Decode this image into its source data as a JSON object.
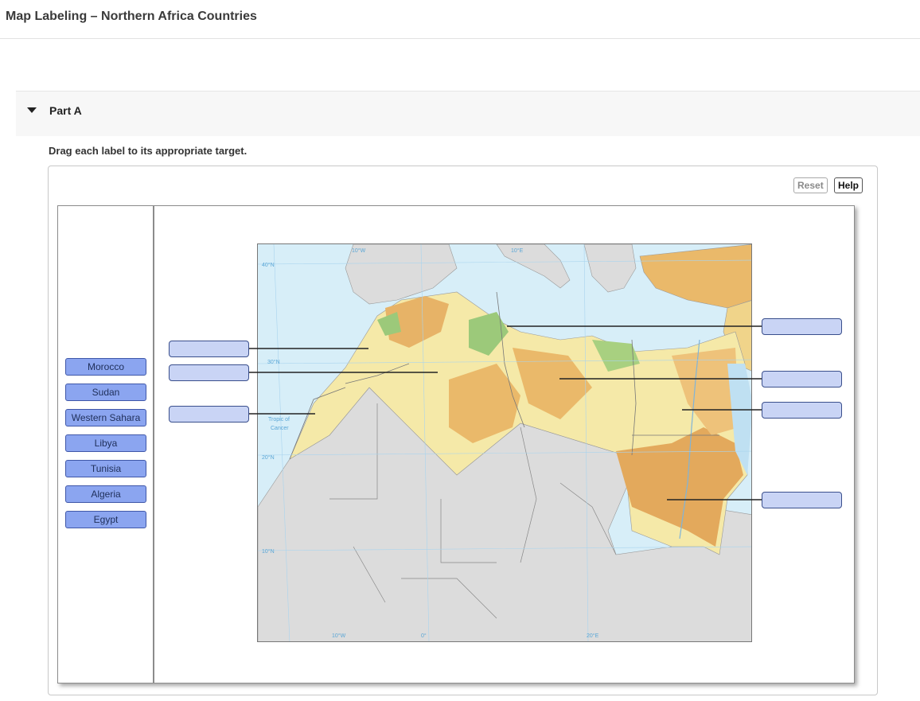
{
  "page": {
    "title": "Map Labeling – Northern Africa Countries"
  },
  "part": {
    "label": "Part A"
  },
  "instructions": "Drag each label to its appropriate target.",
  "toolbar": {
    "reset_label": "Reset",
    "help_label": "Help"
  },
  "labels": [
    "Morocco",
    "Sudan",
    "Western Sahara",
    "Libya",
    "Tunisia",
    "Algeria",
    "Egypt"
  ],
  "map": {
    "lat_40": "40°N",
    "lat_30": "30°N",
    "lat_20": "20°N",
    "lat_10": "10°N",
    "lon_10w_top": "10°W",
    "lon_10e_top": "10°E",
    "lon_10w_bottom": "10°W",
    "lon_0": "0°",
    "lon_20e": "20°E",
    "tropic_1": "Tropic of",
    "tropic_2": "Cancer"
  },
  "colors": {
    "label_fill": "#8ba5f0",
    "target_fill": "#c9d4f5",
    "ocean": "#d7eef8",
    "land_grey": "#dcdcdc",
    "terrain_yellow": "#f5e9a8",
    "terrain_orange": "#eab96a",
    "terrain_green": "#9cc97a"
  }
}
